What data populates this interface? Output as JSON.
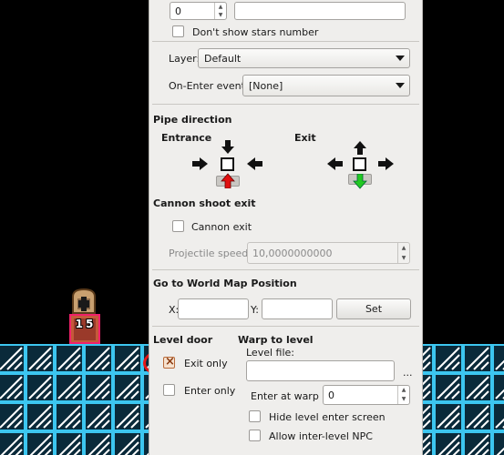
{
  "colors": {
    "panel_bg": "#efeeec",
    "tile_fill": "#0a2a3a",
    "tile_stripe": "#3cc6f0",
    "highlight": "#e81616",
    "entrance_arrow": "#e01010",
    "exit_arrow": "#22c922"
  },
  "stars": {
    "value": "0",
    "text_value": "",
    "hide_label": "Don't show stars number"
  },
  "layer": {
    "label": "Layer:",
    "value": "Default"
  },
  "on_enter": {
    "label": "On-Enter event:",
    "value": "[None]"
  },
  "pipe": {
    "title": "Pipe direction",
    "entrance_label": "Entrance",
    "exit_label": "Exit",
    "entrance_selected": "up",
    "exit_selected": "down"
  },
  "cannon": {
    "title": "Cannon shoot exit",
    "checkbox_label": "Cannon exit",
    "speed_label": "Projectile speed:",
    "speed_value": "10,0000000000"
  },
  "worldmap": {
    "title": "Go to World Map Position",
    "x_label": "X:",
    "y_label": "Y:",
    "x_value": "",
    "y_value": "",
    "set_button": "Set"
  },
  "level_door": {
    "title": "Level door",
    "exit_only": "Exit only",
    "exit_only_checked": true,
    "enter_only": "Enter only",
    "enter_only_checked": false
  },
  "warp_to_level": {
    "title": "Warp to level",
    "file_label": "Level file:",
    "file_value": "",
    "browse": "...",
    "enter_warp_label": "Enter at warp #",
    "enter_warp_value": "0",
    "hide_enter_label": "Hide level enter screen",
    "allow_npc_label": "Allow inter-level NPC"
  },
  "door_object": {
    "warp_number": "15",
    "icon": "door-icon"
  }
}
